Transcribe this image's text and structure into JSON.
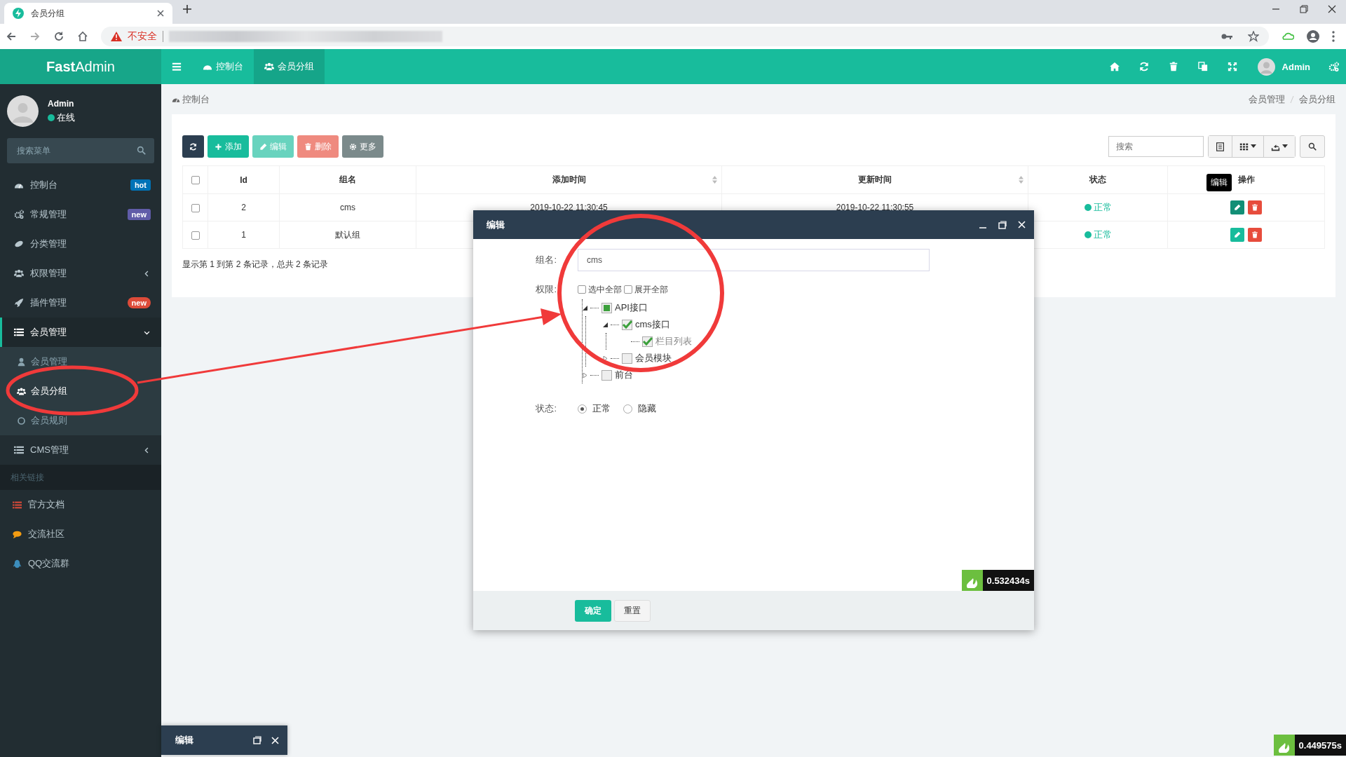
{
  "browser": {
    "tab_title": "会员分组",
    "security_label": "不安全"
  },
  "header": {
    "logo": "**Fast**Admin",
    "nav_tabs": [
      {
        "label": "控制台",
        "selected": false
      },
      {
        "label": "会员分组",
        "selected": true
      }
    ],
    "user_name": "Admin"
  },
  "sidebar": {
    "user": {
      "name": "Admin",
      "status": "在线"
    },
    "search": {
      "placeholder": "搜索菜单"
    },
    "items": [
      {
        "label": "控制台",
        "selected": false,
        "badge": {
          "text": "hot",
          "color": "#0073b7"
        }
      },
      {
        "label": "常规管理",
        "selected": false,
        "badge": {
          "text": "new",
          "color": "#605ca8"
        }
      },
      {
        "label": "分类管理",
        "selected": false
      },
      {
        "label": "权限管理",
        "selected": false,
        "expanded": false
      },
      {
        "label": "插件管理",
        "selected": false,
        "badge": {
          "text": "new",
          "color": "#dd4b39"
        }
      },
      {
        "label": "会员管理",
        "selected": true,
        "expanded": true,
        "children": [
          {
            "label": "会员管理",
            "selected": false
          },
          {
            "label": "会员分组",
            "selected": true
          },
          {
            "label": "会员规则",
            "selected": false
          }
        ]
      },
      {
        "label": "CMS管理",
        "selected": false,
        "expanded": false
      }
    ],
    "section_label": "相关链接",
    "links": [
      {
        "label": "官方文档"
      },
      {
        "label": "交流社区"
      },
      {
        "label": "QQ交流群"
      }
    ]
  },
  "breadcrumb": {
    "home": "控制台",
    "trail": [
      "会员管理",
      "会员分组"
    ]
  },
  "toolbar": {
    "buttons": [
      {
        "kind": "dark",
        "disabled": false
      },
      {
        "kind": "success",
        "label": "添加",
        "disabled": false
      },
      {
        "kind": "success",
        "label": "编辑",
        "disabled": true
      },
      {
        "kind": "danger",
        "label": "删除",
        "disabled": true
      },
      {
        "kind": "info",
        "label": "更多",
        "disabled": false
      }
    ],
    "search": {
      "placeholder": "搜索"
    }
  },
  "table": {
    "columns": [
      {
        "kind": "check",
        "checked": false
      },
      {
        "label": "Id",
        "sortable": false
      },
      {
        "label": "组名",
        "sortable": false
      },
      {
        "label": "添加时间",
        "sortable": true
      },
      {
        "label": "更新时间",
        "sortable": true
      },
      {
        "label": "状态",
        "sortable": false
      },
      {
        "label": "操作",
        "sortable": false
      }
    ],
    "rows": [
      {
        "checked": false,
        "id": "2",
        "name": "cms",
        "add_time": "2019-10-22 11:30:45",
        "update_time": "2019-10-22 11:30:55",
        "status": "正常",
        "tooltip": "编辑"
      },
      {
        "checked": false,
        "id": "1",
        "name": "默认组",
        "status": "正常"
      }
    ],
    "info": "显示第 1 到第 2 条记录，总共 2 条记录"
  },
  "modal": {
    "title": "编辑",
    "name_label": "组名:",
    "name_value": "cms",
    "rules_label": "权限:",
    "options": [
      {
        "label": "选中全部",
        "checked": false
      },
      {
        "label": "展开全部",
        "checked": false
      }
    ],
    "tree": [
      {
        "label": "API接口",
        "checked": false,
        "partial": true,
        "expanded": true,
        "children": [
          {
            "label": "cms接口",
            "checked": true,
            "expanded": true,
            "children": [
              {
                "label": "栏目列表",
                "checked": true
              }
            ]
          },
          {
            "label": "会员模块",
            "checked": false,
            "partial": false,
            "expanded": false
          }
        ]
      },
      {
        "label": "前台",
        "checked": false,
        "partial": false,
        "expanded": false
      }
    ],
    "status_label": "状态:",
    "status_options": [
      {
        "label": "正常",
        "selected": true
      },
      {
        "label": "隐藏",
        "selected": false
      }
    ],
    "buttons": [
      {
        "kind": "primary",
        "label": "确定"
      },
      {
        "kind": "default",
        "label": "重置"
      }
    ],
    "timing": "0.532434s"
  },
  "dock": {
    "title": "编辑"
  },
  "timing": "0.449575s"
}
